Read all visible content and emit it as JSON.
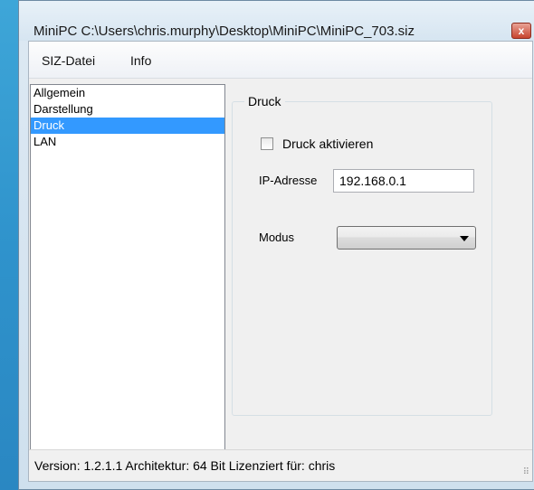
{
  "window": {
    "title": "MiniPC C:\\Users\\chris.murphy\\Desktop\\MiniPC\\MiniPC_703.siz",
    "close_glyph": "x"
  },
  "menu": {
    "items": [
      {
        "label": "SIZ-Datei"
      },
      {
        "label": "Info"
      }
    ]
  },
  "nav": {
    "items": [
      {
        "label": "Allgemein",
        "selected": false
      },
      {
        "label": "Darstellung",
        "selected": false
      },
      {
        "label": "Druck",
        "selected": true
      },
      {
        "label": "LAN",
        "selected": false
      }
    ]
  },
  "druck": {
    "group_title": "Druck",
    "enable_checkbox": {
      "label": "Druck aktivieren",
      "checked": false
    },
    "ip": {
      "label": "IP-Adresse",
      "value": "192.168.0.1"
    },
    "mode": {
      "label": "Modus",
      "value": ""
    }
  },
  "status": {
    "text": "Version: 1.2.1.1 Architektur: 64 Bit Lizenziert für: chris",
    "grip_glyph": "⠿"
  },
  "colors": {
    "selection": "#3399ff",
    "desktop": "#3ea6d8"
  }
}
